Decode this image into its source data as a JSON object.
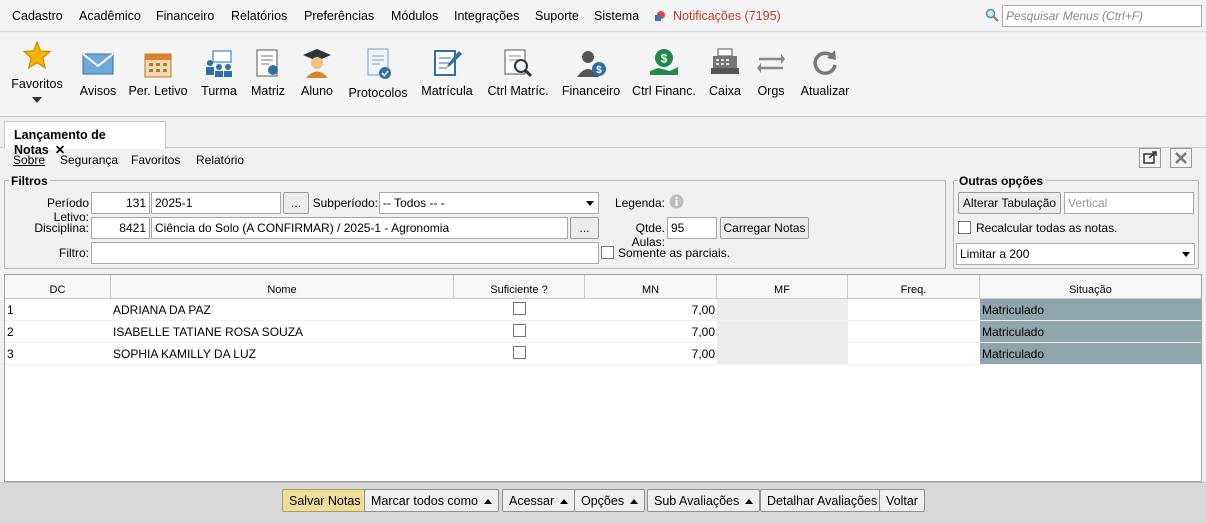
{
  "menubar": {
    "items": [
      "Cadastro",
      "Acadêmico",
      "Financeiro",
      "Relatórios",
      "Preferências",
      "Módulos",
      "Integrações",
      "Suporte",
      "Sistema"
    ],
    "notifications": "Notificações (7195)",
    "search_placeholder": "Pesquisar Menus (Ctrl+F)"
  },
  "toolbar": {
    "items": [
      "Favoritos",
      "Avisos",
      "Per. Letivo",
      "Turma",
      "Matriz",
      "Aluno",
      "Protocolos",
      "Matrícula",
      "Ctrl Matríc.",
      "Financeiro",
      "Ctrl Financ.",
      "Caixa",
      "Orgs",
      "Atualizar"
    ]
  },
  "tab": {
    "label": "Lançamento de Notas",
    "close": "✕"
  },
  "submenu": {
    "items": [
      "Sobre",
      "Segurança",
      "Favoritos",
      "Relatório"
    ]
  },
  "filtros": {
    "legend": "Filtros",
    "periodo_label": "Período Letivo:",
    "periodo_code": "131",
    "periodo_value": "2025-1",
    "subperiodo_label": "Subperíodo:",
    "subperiodo_value": "-- Todos -- -",
    "legenda_label": "Legenda:",
    "disciplina_label": "Disciplina:",
    "disciplina_code": "8421",
    "disciplina_value": "Ciência do Solo (A CONFIRMAR) / 2025-1 - Agronomia",
    "qtde_label": "Qtde. Aulas:",
    "qtde_value": "95",
    "carregar_label": "Carregar Notas",
    "filtro_label": "Filtro:",
    "filtro_value": "",
    "somente_label": "Somente as parciais.",
    "ellipsis": "..."
  },
  "outras": {
    "legend": "Outras opções",
    "alterar_label": "Alterar Tabulação",
    "vertical_placeholder": "Vertical",
    "recalcular_label": "Recalcular todas as notas.",
    "limitar_value": "Limitar a 200"
  },
  "grid": {
    "columns": [
      "DC",
      "Nome",
      "Suficiente ?",
      "MN",
      "MF",
      "Freq.",
      "Situação"
    ],
    "rows": [
      {
        "dc": "1",
        "nome": "ADRIANA DA PAZ",
        "mn": "7,00",
        "mf": "",
        "freq": "",
        "situacao": "Matriculado"
      },
      {
        "dc": "2",
        "nome": "ISABELLE TATIANE ROSA SOUZA",
        "mn": "7,00",
        "mf": "",
        "freq": "",
        "situacao": "Matriculado"
      },
      {
        "dc": "3",
        "nome": "SOPHIA KAMILLY DA LUZ",
        "mn": "7,00",
        "mf": "",
        "freq": "",
        "situacao": "Matriculado"
      }
    ]
  },
  "bottom": {
    "buttons": [
      "Salvar Notas",
      "Marcar todos como",
      "Acessar",
      "Opções",
      "Sub Avaliações",
      "Detalhar Avaliações",
      "Voltar"
    ]
  },
  "colors": {
    "situacao_bg": "#8fa5ae",
    "mf_bg": "#ececec",
    "salvar_bg": "#eedd9a"
  }
}
